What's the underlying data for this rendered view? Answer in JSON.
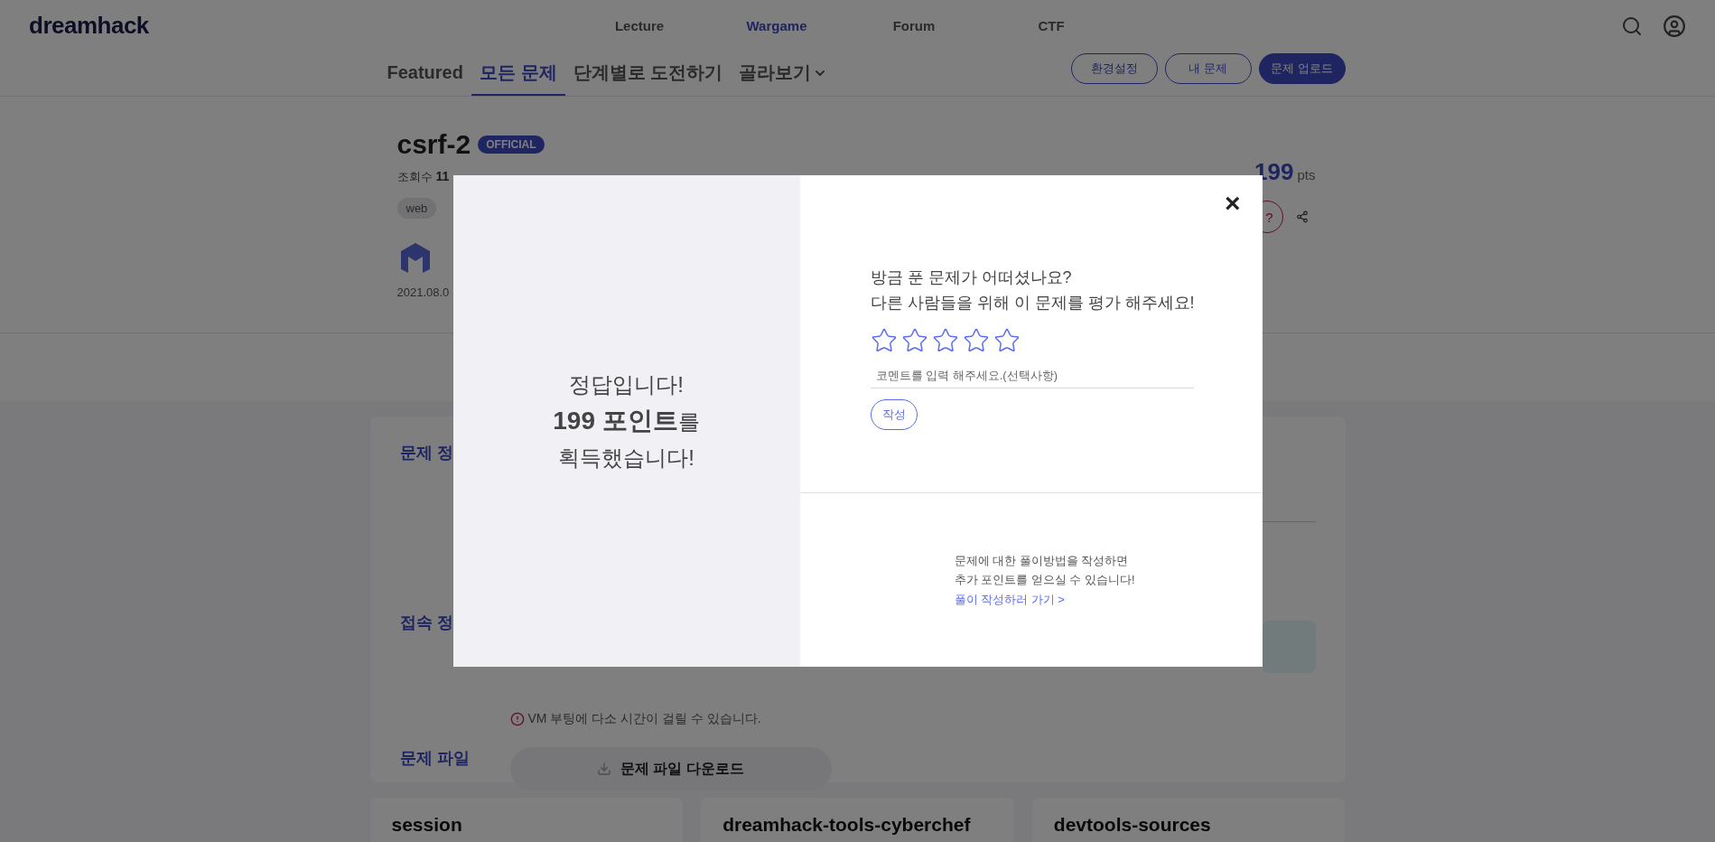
{
  "header": {
    "logo": "dreamhack",
    "nav": [
      {
        "label": "Lecture",
        "selected": false
      },
      {
        "label": "Wargame",
        "selected": true
      },
      {
        "label": "Forum",
        "selected": false
      },
      {
        "label": "CTF",
        "selected": false
      }
    ]
  },
  "subnav": {
    "tabs": [
      {
        "label": "Featured",
        "selected": false
      },
      {
        "label": "모든 문제",
        "selected": true
      },
      {
        "label": "단계별로 도전하기",
        "selected": false
      },
      {
        "label": "골라보기",
        "selected": false,
        "dropdown": true
      }
    ],
    "buttons": [
      {
        "label": "환경설정",
        "primary": false
      },
      {
        "label": "내 문제",
        "primary": false
      },
      {
        "label": "문제 업로드",
        "primary": true
      }
    ]
  },
  "challenge": {
    "title": "csrf-2",
    "badge": "OFFICIAL",
    "meta_label": "조회수",
    "meta_value": "11",
    "tag": "web",
    "date": "2021.08.0",
    "points": "199",
    "points_unit": "pts",
    "question_button": "?"
  },
  "sections": [
    {
      "label": "문제 정"
    },
    {
      "label": "접속 정"
    },
    {
      "label": "문제 파일"
    }
  ],
  "vm_note": "VM 부팅에 다소 시간이 걸릴 수 있습니다.",
  "download_button": "문제 파일 다운로드",
  "related": [
    {
      "title": "session"
    },
    {
      "title": "dreamhack-tools-cyberchef"
    },
    {
      "title": "devtools-sources"
    }
  ],
  "modal": {
    "message": [
      "정답입니다!",
      "**199 포인트**를",
      "획득했습니다!"
    ],
    "close": "×",
    "prompt": [
      "방금 푼 문제가 어떠셨나요?",
      "다른 사람들을 위해 이 문제를 평가 해주세요!"
    ],
    "stars": 0,
    "comment_placeholder": "코멘트를 입력 해주세요.(선택사항)",
    "submit": "작성",
    "writeup_text": [
      "문제에 대한 풀이방법을 작성하면",
      "추가 포인트를 얻으실 수 있습니다!"
    ],
    "writeup_link": "풀이 작성하러 가기 >"
  }
}
